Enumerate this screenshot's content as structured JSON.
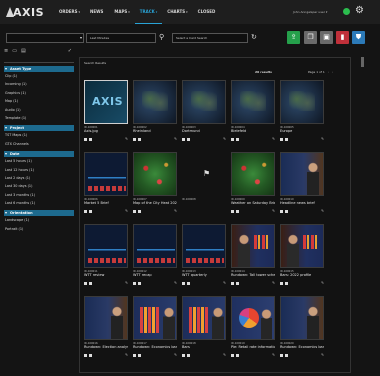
{
  "header": {
    "logo_text": "AXIS",
    "nav": [
      {
        "label": "ORDERS",
        "chev": "▾"
      },
      {
        "label": "NEWS",
        "chev": ""
      },
      {
        "label": "MAPS",
        "chev": "▾"
      },
      {
        "label": "TRACK",
        "chev": "▾"
      },
      {
        "label": "CHARTS",
        "chev": "▾"
      },
      {
        "label": "CLOSED",
        "chev": ""
      }
    ],
    "user": "John Anngelsper user ▾",
    "status_color": "#2bbd4e",
    "gear": "⚙"
  },
  "toolbar": {
    "search_value": "",
    "search_icon": "▾",
    "filter1_value": "Last Minutes",
    "filter2_value": "Select a Card Search",
    "search_glass": "⚲",
    "refresh": "↻",
    "actions": {
      "upload": "⇪",
      "copy": "❐",
      "folder": "▣",
      "delete": "▮",
      "settings": "⛊"
    }
  },
  "sidebar": {
    "tool_icons": [
      "≡",
      "▭",
      "▤"
    ],
    "check": "✓",
    "filter_placeholder": "Filter",
    "facets": [
      {
        "title": "Asset Type",
        "items": [
          "Clip (1)",
          "Incoming (1)",
          "Graphics (1)",
          "Map (1)",
          "Audio (1)",
          "Template (1)"
        ]
      },
      {
        "title": "Project",
        "items": [
          "TST Maps (1)",
          "GTX Channels"
        ]
      },
      {
        "title": "Date",
        "items": [
          "Last 5 hours (1)",
          "Last 12 hours (1)",
          "Last 2 days (1)",
          "Last 30 days (1)",
          "Last 3 months (1)",
          "Last 6 months (1)"
        ]
      },
      {
        "title": "Orientation",
        "items": [
          "Landscape (1)",
          "Portrait (1)"
        ]
      }
    ]
  },
  "main": {
    "title": "Search Results",
    "results_count": "20 results",
    "pager": "Page 1 of 1",
    "pager_prev": "‹",
    "pager_next": "›",
    "cards": [
      {
        "id": "ID-100001",
        "title": "Axis.jpg",
        "icons": [
          "▪",
          "▪"
        ],
        "right": "✎",
        "thumb": "logo"
      },
      {
        "id": "ID-100002",
        "title": "Rheinland",
        "icons": [
          "▪",
          "▪"
        ],
        "right": "✎",
        "thumb": "map"
      },
      {
        "id": "ID-100003",
        "title": "Dortmund",
        "icons": [
          "▪",
          "▪"
        ],
        "right": "✎",
        "thumb": "map"
      },
      {
        "id": "ID-100004",
        "title": "Bielefeld",
        "icons": [
          "▪",
          "▪"
        ],
        "right": "✎",
        "thumb": "map"
      },
      {
        "id": "ID-100005",
        "title": "Europe",
        "icons": [
          "▪",
          "▪"
        ],
        "right": "✎",
        "thumb": "map"
      },
      {
        "id": "ID-100006",
        "title": "Market 5 Brief",
        "icons": [
          "▪",
          "▪"
        ],
        "right": "✎",
        "thumb": "dash"
      },
      {
        "id": "ID-100007",
        "title": "Map of the City Heat 2020 Weather",
        "icons": [
          "▪",
          "▪"
        ],
        "right": "✎",
        "thumb": "green"
      },
      {
        "id": "ID-100008",
        "title": "",
        "icons": [],
        "right": "",
        "thumb": "empty"
      },
      {
        "id": "ID-100009",
        "title": "Weather on Saturday Brief 2020",
        "icons": [
          "▪",
          "▪"
        ],
        "right": "✎",
        "thumb": "green"
      },
      {
        "id": "ID-100010",
        "title": "Headline news brief",
        "icons": [
          "▪",
          "▪"
        ],
        "right": "✎",
        "thumb": "news"
      },
      {
        "id": "ID-100011",
        "title": "WTT review",
        "icons": [
          "▪",
          "▪"
        ],
        "right": "✎",
        "thumb": "dash"
      },
      {
        "id": "ID-100012",
        "title": "WTT recap",
        "icons": [
          "▪",
          "▪"
        ],
        "right": "✎",
        "thumb": "dash"
      },
      {
        "id": "ID-100013",
        "title": "WTT quarterly",
        "icons": [
          "▪",
          "▪"
        ],
        "right": "✎",
        "thumb": "dash"
      },
      {
        "id": "ID-100014",
        "title": "Rundown: Tall tower scheduled",
        "icons": [
          "▪",
          "▪"
        ],
        "right": "✎",
        "thumb": "news2"
      },
      {
        "id": "ID-100015",
        "title": "Bars: 2022 profile",
        "icons": [
          "▪",
          "▪"
        ],
        "right": "✎",
        "thumb": "news2"
      },
      {
        "id": "ID-100016",
        "title": "Rundown: Election analysis",
        "icons": [
          "▪",
          "▪"
        ],
        "right": "✎",
        "thumb": "news"
      },
      {
        "id": "ID-100017",
        "title": "Rundown: Economics bars",
        "icons": [
          "▪",
          "▪"
        ],
        "right": "✎",
        "thumb": "bars"
      },
      {
        "id": "ID-100018",
        "title": "Bars",
        "icons": [
          "▪",
          "▪"
        ],
        "right": "✎",
        "thumb": "bars"
      },
      {
        "id": "ID-100019",
        "title": "Pie: Retail rate information",
        "icons": [
          "▪",
          "▪"
        ],
        "right": "✎",
        "thumb": "pie"
      },
      {
        "id": "ID-100020",
        "title": "Rundown: Economics bars",
        "icons": [
          "▪",
          "▪"
        ],
        "right": "✎",
        "thumb": "news"
      }
    ]
  }
}
